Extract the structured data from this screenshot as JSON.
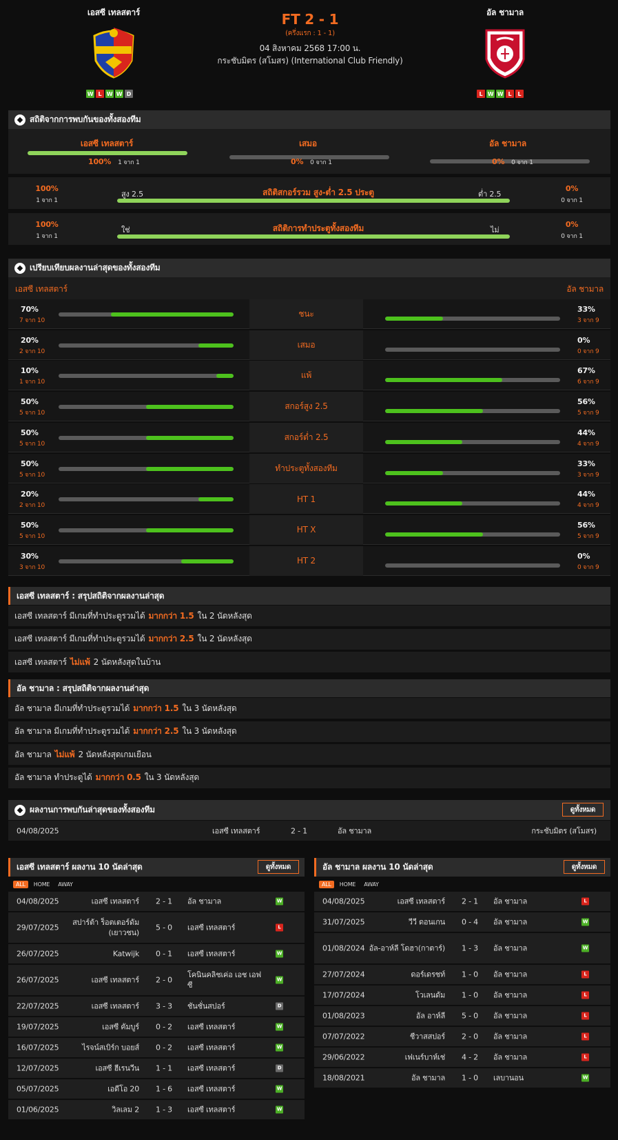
{
  "header": {
    "home_name": "เอสซี เทลสตาร์",
    "away_name": "อัล ชามาล",
    "score": "FT 2 - 1",
    "halftime": "(ครึ่งแรก : 1 - 1)",
    "date": "04 สิงหาคม 2568 17:00 น.",
    "competition": "กระชับมิตร (สโมสร) (International Club Friendly)",
    "home_form": [
      "W",
      "L",
      "W",
      "W",
      "D"
    ],
    "away_form": [
      "L",
      "W",
      "W",
      "L",
      "L"
    ]
  },
  "h2h": {
    "title": "สถิติจากการพบกันของทั้งสองทีม",
    "home_label": "เอสซี เทลสตาร์",
    "draw_label": "เสมอ",
    "away_label": "อัล ชามาล",
    "home_pct": "100%",
    "home_of": "1 จาก 1",
    "draw_pct": "0%",
    "draw_of": "0 จาก 1",
    "away_pct": "0%",
    "away_of": "0 จาก 1",
    "home_fill": 1.0,
    "draw_fill": 0.0,
    "away_fill": 0.0
  },
  "ou": {
    "left_pct": "100%",
    "left_of": "1 จาก 1",
    "over": "สูง 2.5",
    "title": "สถิติสกอร์รวม สูง-ต่ำ 2.5 ประตู",
    "under": "ต่ำ 2.5",
    "right_pct": "0%",
    "right_of": "0 จาก 1",
    "fill": 1.0
  },
  "btts": {
    "left_pct": "100%",
    "left_of": "1 จาก 1",
    "yes": "ใช่",
    "title": "สถิติการทำประตูทั้งสองทีม",
    "no": "ไม่",
    "right_pct": "0%",
    "right_of": "0 จาก 1",
    "fill": 1.0
  },
  "compare": {
    "title": "เปรียบเทียบผลงานล่าสุดของทั้งสองทีม",
    "home_label": "เอสซี เทลสตาร์",
    "away_label": "อัล ชามาล",
    "rows": [
      {
        "label": "ชนะ",
        "hp": "70%",
        "ho": "7 จาก 10",
        "hf": 0.7,
        "ap": "33%",
        "ao": "3 จาก 9",
        "af": 0.33
      },
      {
        "label": "เสมอ",
        "hp": "20%",
        "ho": "2 จาก 10",
        "hf": 0.2,
        "ap": "0%",
        "ao": "0 จาก 9",
        "af": 0.0
      },
      {
        "label": "แพ้",
        "hp": "10%",
        "ho": "1 จาก 10",
        "hf": 0.1,
        "ap": "67%",
        "ao": "6 จาก 9",
        "af": 0.67
      },
      {
        "label": "สกอร์สูง 2.5",
        "hp": "50%",
        "ho": "5 จาก 10",
        "hf": 0.5,
        "ap": "56%",
        "ao": "5 จาก 9",
        "af": 0.56
      },
      {
        "label": "สกอร์ต่ำ 2.5",
        "hp": "50%",
        "ho": "5 จาก 10",
        "hf": 0.5,
        "ap": "44%",
        "ao": "4 จาก 9",
        "af": 0.44
      },
      {
        "label": "ทำประตูทั้งสองทีม",
        "hp": "50%",
        "ho": "5 จาก 10",
        "hf": 0.5,
        "ap": "33%",
        "ao": "3 จาก 9",
        "af": 0.33
      },
      {
        "label": "HT 1",
        "hp": "20%",
        "ho": "2 จาก 10",
        "hf": 0.2,
        "ap": "44%",
        "ao": "4 จาก 9",
        "af": 0.44
      },
      {
        "label": "HT X",
        "hp": "50%",
        "ho": "5 จาก 10",
        "hf": 0.5,
        "ap": "56%",
        "ao": "5 จาก 9",
        "af": 0.56
      },
      {
        "label": "HT 2",
        "hp": "30%",
        "ho": "3 จาก 10",
        "hf": 0.3,
        "ap": "0%",
        "ao": "0 จาก 9",
        "af": 0.0
      }
    ]
  },
  "home_summary": {
    "title": "เอสซี เทลสตาร์ : สรุปสถิติจากผลงานล่าสุด",
    "rows": [
      {
        "pre": "เอสซี เทลสตาร์  มีเกมที่ทำประตูรวมได้",
        "hl": "มากกว่า  1.5",
        "post": "ใน 2 นัดหลังสุด"
      },
      {
        "pre": "เอสซี เทลสตาร์  มีเกมที่ทำประตูรวมได้",
        "hl": "มากกว่า  2.5",
        "post": "ใน 2 นัดหลังสุด"
      },
      {
        "pre": "เอสซี เทลสตาร์",
        "hl": "ไม่แพ้",
        "post": "2  นัดหลังสุดในบ้าน"
      }
    ]
  },
  "away_summary": {
    "title": "อัล ชามาล : สรุปสถิติจากผลงานล่าสุด",
    "rows": [
      {
        "pre": "อัล ชามาล  มีเกมที่ทำประตูรวมได้",
        "hl": "มากกว่า  1.5",
        "post": "ใน 3 นัดหลังสุด"
      },
      {
        "pre": "อัล ชามาล  มีเกมที่ทำประตูรวมได้",
        "hl": "มากกว่า  2.5",
        "post": "ใน 3 นัดหลังสุด"
      },
      {
        "pre": "อัล ชามาล",
        "hl": "ไม่แพ้",
        "post": "2  นัดหลังสุดเกมเยือน"
      },
      {
        "pre": "อัล ชามาล  ทำประตูได้",
        "hl": "มากกว่า  0.5",
        "post": "ใน 3 นัดหลังสุด"
      }
    ]
  },
  "h2h_results": {
    "title": "ผลงานการพบกันล่าสุดของทั้งสองทีม",
    "view_all": "ดูทั้งหมด",
    "rows": [
      {
        "date": "04/08/2025",
        "home": "เอสซี เทลสตาร์",
        "score": "2 - 1",
        "away": "อัล ชามาล",
        "comp": "กระชับมิตร (สโมสร)"
      }
    ]
  },
  "home_last": {
    "title": "เอสซี เทลสตาร์ ผลงาน 10 นัดล่าสุด",
    "view_all": "ดูทั้งหมด",
    "tabs": [
      "ALL",
      "HOME",
      "AWAY"
    ],
    "rows": [
      {
        "date": "04/08/2025",
        "home": "เอสซี เทลสตาร์",
        "score": "2 - 1",
        "away": "อัล ชามาล",
        "res": "W"
      },
      {
        "date": "29/07/2025",
        "home": "สปาร์ต้า ร็อตเตอร์ดัม (เยาวชน)",
        "score": "5 - 0",
        "away": "เอสซี เทลสตาร์",
        "res": "L"
      },
      {
        "date": "26/07/2025",
        "home": "Katwijk",
        "score": "0 - 1",
        "away": "เอสซี เทลสตาร์",
        "res": "W"
      },
      {
        "date": "26/07/2025",
        "home": "เอสซี เทลสตาร์",
        "score": "2 - 0",
        "away": "โคนินคลิชเค่อ เอช เอฟซี",
        "res": "W"
      },
      {
        "date": "22/07/2025",
        "home": "เอสซี เทลสตาร์",
        "score": "3 - 3",
        "away": "ชันชั่นสปอร์",
        "res": "D"
      },
      {
        "date": "19/07/2025",
        "home": "เอสซี คัมบูร์",
        "score": "0 - 2",
        "away": "เอสซี เทลสตาร์",
        "res": "W"
      },
      {
        "date": "16/07/2025",
        "home": "ไรจน์สเบิร์ก บอยส์",
        "score": "0 - 2",
        "away": "เอสซี เทลสตาร์",
        "res": "W"
      },
      {
        "date": "12/07/2025",
        "home": "เอสซี ฮีเรนวีน",
        "score": "1 - 1",
        "away": "เอสซี เทลสตาร์",
        "res": "D"
      },
      {
        "date": "05/07/2025",
        "home": "เอดีโอ 20",
        "score": "1 - 6",
        "away": "เอสซี เทลสตาร์",
        "res": "W"
      },
      {
        "date": "01/06/2025",
        "home": "วิลเลม 2",
        "score": "1 - 3",
        "away": "เอสซี เทลสตาร์",
        "res": "W"
      }
    ]
  },
  "away_last": {
    "title": "อัล ชามาล ผลงาน 10 นัดล่าสุด",
    "view_all": "ดูทั้งหมด",
    "tabs": [
      "ALL",
      "HOME",
      "AWAY"
    ],
    "rows": [
      {
        "date": "04/08/2025",
        "home": "เอสซี เทลสตาร์",
        "score": "2 - 1",
        "away": "อัล ชามาล",
        "res": "L"
      },
      {
        "date": "31/07/2025",
        "home": "วีวี ดอนเกน",
        "score": "0 - 4",
        "away": "อัล ชามาล",
        "res": "W"
      },
      {
        "date": "01/08/2024",
        "home": "อัล-อาห์ลี โดฮา(กาตาร์)",
        "score": "1 - 3",
        "away": "อัล ชามาล",
        "res": "W"
      },
      {
        "date": "27/07/2024",
        "home": "ดอร์เดรชท์",
        "score": "1 - 0",
        "away": "อัล ชามาล",
        "res": "L"
      },
      {
        "date": "17/07/2024",
        "home": "โวเลนดัม",
        "score": "1 - 0",
        "away": "อัล ชามาล",
        "res": "L"
      },
      {
        "date": "01/08/2023",
        "home": "อัล อาห์ลี",
        "score": "5 - 0",
        "away": "อัล ชามาล",
        "res": "L"
      },
      {
        "date": "07/07/2022",
        "home": "ชีวาสสปอร์",
        "score": "2 - 0",
        "away": "อัล ชามาล",
        "res": "L"
      },
      {
        "date": "29/06/2022",
        "home": "เฟเนร์บาห์เช่",
        "score": "4 - 2",
        "away": "อัล ชามาล",
        "res": "L"
      },
      {
        "date": "18/08/2021",
        "home": "อัล ชามาล",
        "score": "1 - 0",
        "away": "เลบานอน",
        "res": "W"
      }
    ]
  }
}
